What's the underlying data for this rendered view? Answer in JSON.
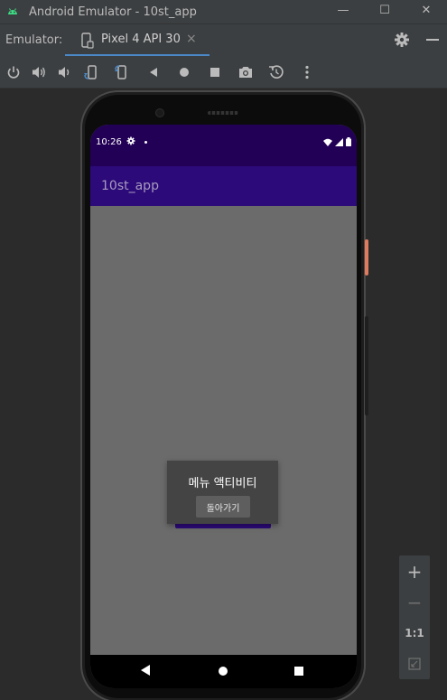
{
  "window": {
    "title": "Android Emulator - 10st_app",
    "minimize_glyph": "—",
    "maximize_glyph": "☐",
    "close_glyph": "✕"
  },
  "tabbar": {
    "emulator_label": "Emulator:",
    "tab_label": "Pixel 4 API 30",
    "tab_close_glyph": "×"
  },
  "toolbar": {
    "icons": [
      "power-icon",
      "volume-up-icon",
      "volume-down-icon",
      "rotate-left-icon",
      "rotate-right-icon",
      "back-icon",
      "home-icon",
      "overview-icon",
      "screenshot-icon",
      "snapshot-icon",
      "more-icon"
    ]
  },
  "device": {
    "status_bar": {
      "time": "10:26"
    },
    "app_bar": {
      "title": "10st_app"
    },
    "dialog": {
      "title": "메뉴 액티비티",
      "button_label": "돌아가기"
    }
  },
  "zoom_panel": {
    "zoom_in": "+",
    "zoom_out": "−",
    "one_to_one": "1:1"
  },
  "colors": {
    "ide_bg": "#3c3f41",
    "emu_bg": "#2b2b2b",
    "tab_accent": "#4a88c7",
    "status_bar": "#220055",
    "app_bar": "#2c0a79",
    "dim_content": "#6b6b6b",
    "dialog_bg": "#444444"
  }
}
